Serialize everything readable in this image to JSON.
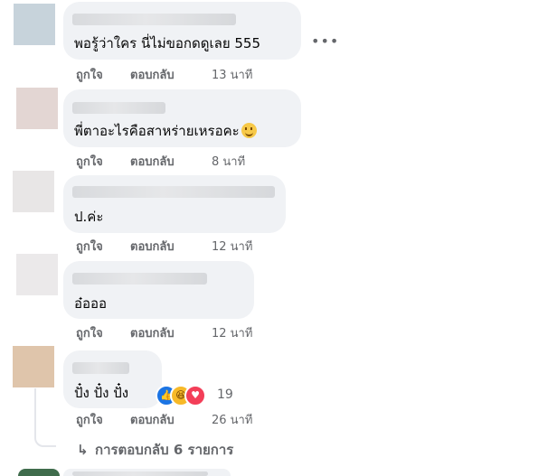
{
  "comments": [
    {
      "text": "พอรู้ว่าใคร นี่ไม่ขอกดดูเลย 555",
      "like": "ถูกใจ",
      "reply": "ตอบกลับ",
      "time": "13 นาที"
    },
    {
      "text": "พี่ตาอะไรคือสาหร่ายเหรอคะ",
      "like": "ถูกใจ",
      "reply": "ตอบกลับ",
      "time": "8 นาที"
    },
    {
      "text": "ป.ค่ะ",
      "like": "ถูกใจ",
      "reply": "ตอบกลับ",
      "time": "12 นาที"
    },
    {
      "text": "อ๋อออ",
      "like": "ถูกใจ",
      "reply": "ตอบกลับ",
      "time": "12 นาที"
    },
    {
      "text": "ปั๋ง ปั๋ง ปั๋ง",
      "like": "ถูกใจ",
      "reply": "ตอบกลับ",
      "time": "26 นาที",
      "reactions": {
        "icons": [
          "like-icon",
          "haha-icon",
          "love-icon"
        ],
        "count": "19"
      }
    }
  ],
  "replies_link": "การตอบกลับ 6 รายการ",
  "more_icon": "more-horizontal-icon",
  "colors": {
    "bubble": "#f0f2f5",
    "secondary_text": "#65676b",
    "like_blue": "#1b74e4",
    "love_red": "#f33e58",
    "haha_yellow": "#f7b928"
  }
}
